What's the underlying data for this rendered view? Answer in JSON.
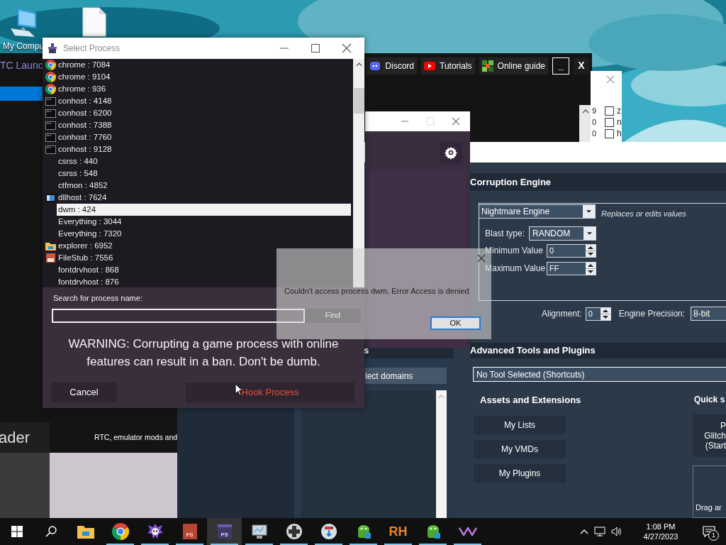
{
  "desktop_icons": [
    {
      "kind": "computer",
      "label": "My Compu"
    },
    {
      "kind": "file"
    }
  ],
  "launcher": {
    "title": "TC Launc",
    "links": [
      {
        "kind": "discord",
        "label": "Discord"
      },
      {
        "kind": "youtube",
        "label": "Tutorials"
      },
      {
        "kind": "guide",
        "label": "Online guide"
      }
    ],
    "minimize": "_",
    "close": "X",
    "heading": "ader",
    "tagline": "RTC, emulator mods and"
  },
  "list_window": {
    "rows": [
      {
        "value": "9",
        "label": "z",
        "checked": false
      },
      {
        "value": "0",
        "label": "n",
        "checked": false
      },
      {
        "value": "0",
        "label": "h",
        "checked": false
      }
    ]
  },
  "rtc": {
    "corruption_engine": {
      "title": "Corruption Engine",
      "engine": "Nightmare Engine",
      "description": "Replaces or edits values",
      "blast_type_label": "Blast type:",
      "blast_type": "RANDOM",
      "min_label": "Minimum Value",
      "min": "0",
      "max_label": "Maximum Value",
      "max": "FF",
      "alignment_label": "Alignment:",
      "alignment": "0",
      "precision_label": "Engine Precision:",
      "precision": "8-bit"
    },
    "domains": {
      "title": "s",
      "button": "lect domains"
    },
    "advanced": {
      "title": "Advanced Tools and Plugins",
      "tool": "No Tool Selected (Shortcuts)",
      "assets_title": "Assets and Extensions",
      "assets_buttons": [
        "My Lists",
        "My VMDs",
        "My Plugins"
      ],
      "quick_title": "Quick s",
      "quick_button": [
        "P",
        "Glitch",
        "(Start"
      ],
      "drop_hint": "Drag ar"
    }
  },
  "select_process": {
    "title": "Select Process",
    "processes": [
      {
        "name": "chrome : 7084",
        "kind": "chrome",
        "selected": false
      },
      {
        "name": "chrome : 9104",
        "kind": "chrome",
        "selected": false
      },
      {
        "name": "chrome : 936",
        "kind": "chrome",
        "selected": false
      },
      {
        "name": "conhost : 4148",
        "kind": "console",
        "selected": false
      },
      {
        "name": "conhost : 6200",
        "kind": "console",
        "selected": false
      },
      {
        "name": "conhost : 7388",
        "kind": "console",
        "selected": false
      },
      {
        "name": "conhost : 7760",
        "kind": "console",
        "selected": false
      },
      {
        "name": "conhost : 9128",
        "kind": "console",
        "selected": false
      },
      {
        "name": "csrss : 440",
        "kind": "plain",
        "selected": false
      },
      {
        "name": "csrss : 548",
        "kind": "plain",
        "selected": false
      },
      {
        "name": "ctfmon : 4852",
        "kind": "plain",
        "selected": false
      },
      {
        "name": "dllhost : 7624",
        "kind": "window",
        "selected": false
      },
      {
        "name": "dwm : 424",
        "kind": "plain",
        "selected": true
      },
      {
        "name": "Everything : 3044",
        "kind": "plain",
        "selected": false
      },
      {
        "name": "Everything : 7320",
        "kind": "plain",
        "selected": false
      },
      {
        "name": "explorer : 6952",
        "kind": "folder",
        "selected": false
      },
      {
        "name": "FileStub : 7556",
        "kind": "app",
        "selected": false
      },
      {
        "name": "fontdrvhost : 868",
        "kind": "plain",
        "selected": false
      },
      {
        "name": "fontdrvhost : 876",
        "kind": "plain",
        "selected": false
      }
    ],
    "search_label": "Search for process name:",
    "find": "Find",
    "warning": "WARNING: Corrupting a game process with online features can result in a ban.  Don't be dumb.",
    "cancel": "Cancel",
    "hook": "Hook Process"
  },
  "error_dialog": {
    "message": "Couldn't access process dwm. Error Access is denied",
    "ok": "OK"
  },
  "taskbar": {
    "apps": [
      {
        "kind": "folder",
        "active": false,
        "running": false
      },
      {
        "kind": "chrome",
        "active": false,
        "running": true
      },
      {
        "kind": "skull",
        "active": false,
        "running": true
      },
      {
        "kind": "tile",
        "label": "FS",
        "active": false,
        "running": true
      },
      {
        "kind": "computer",
        "label": "P5",
        "active": true,
        "running": true
      },
      {
        "kind": "monitor",
        "active": false,
        "running": true
      },
      {
        "kind": "gamepad",
        "active": false,
        "running": true
      },
      {
        "kind": "globe",
        "active": false,
        "running": true
      },
      {
        "kind": "android",
        "active": false,
        "running": true
      },
      {
        "kind": "text",
        "label": "RH",
        "active": false,
        "running": true
      },
      {
        "kind": "android",
        "active": false,
        "running": true
      },
      {
        "kind": "chevron",
        "active": false,
        "running": true
      }
    ],
    "time": "1:08 PM",
    "date": "4/27/2023",
    "notifications": "1"
  }
}
